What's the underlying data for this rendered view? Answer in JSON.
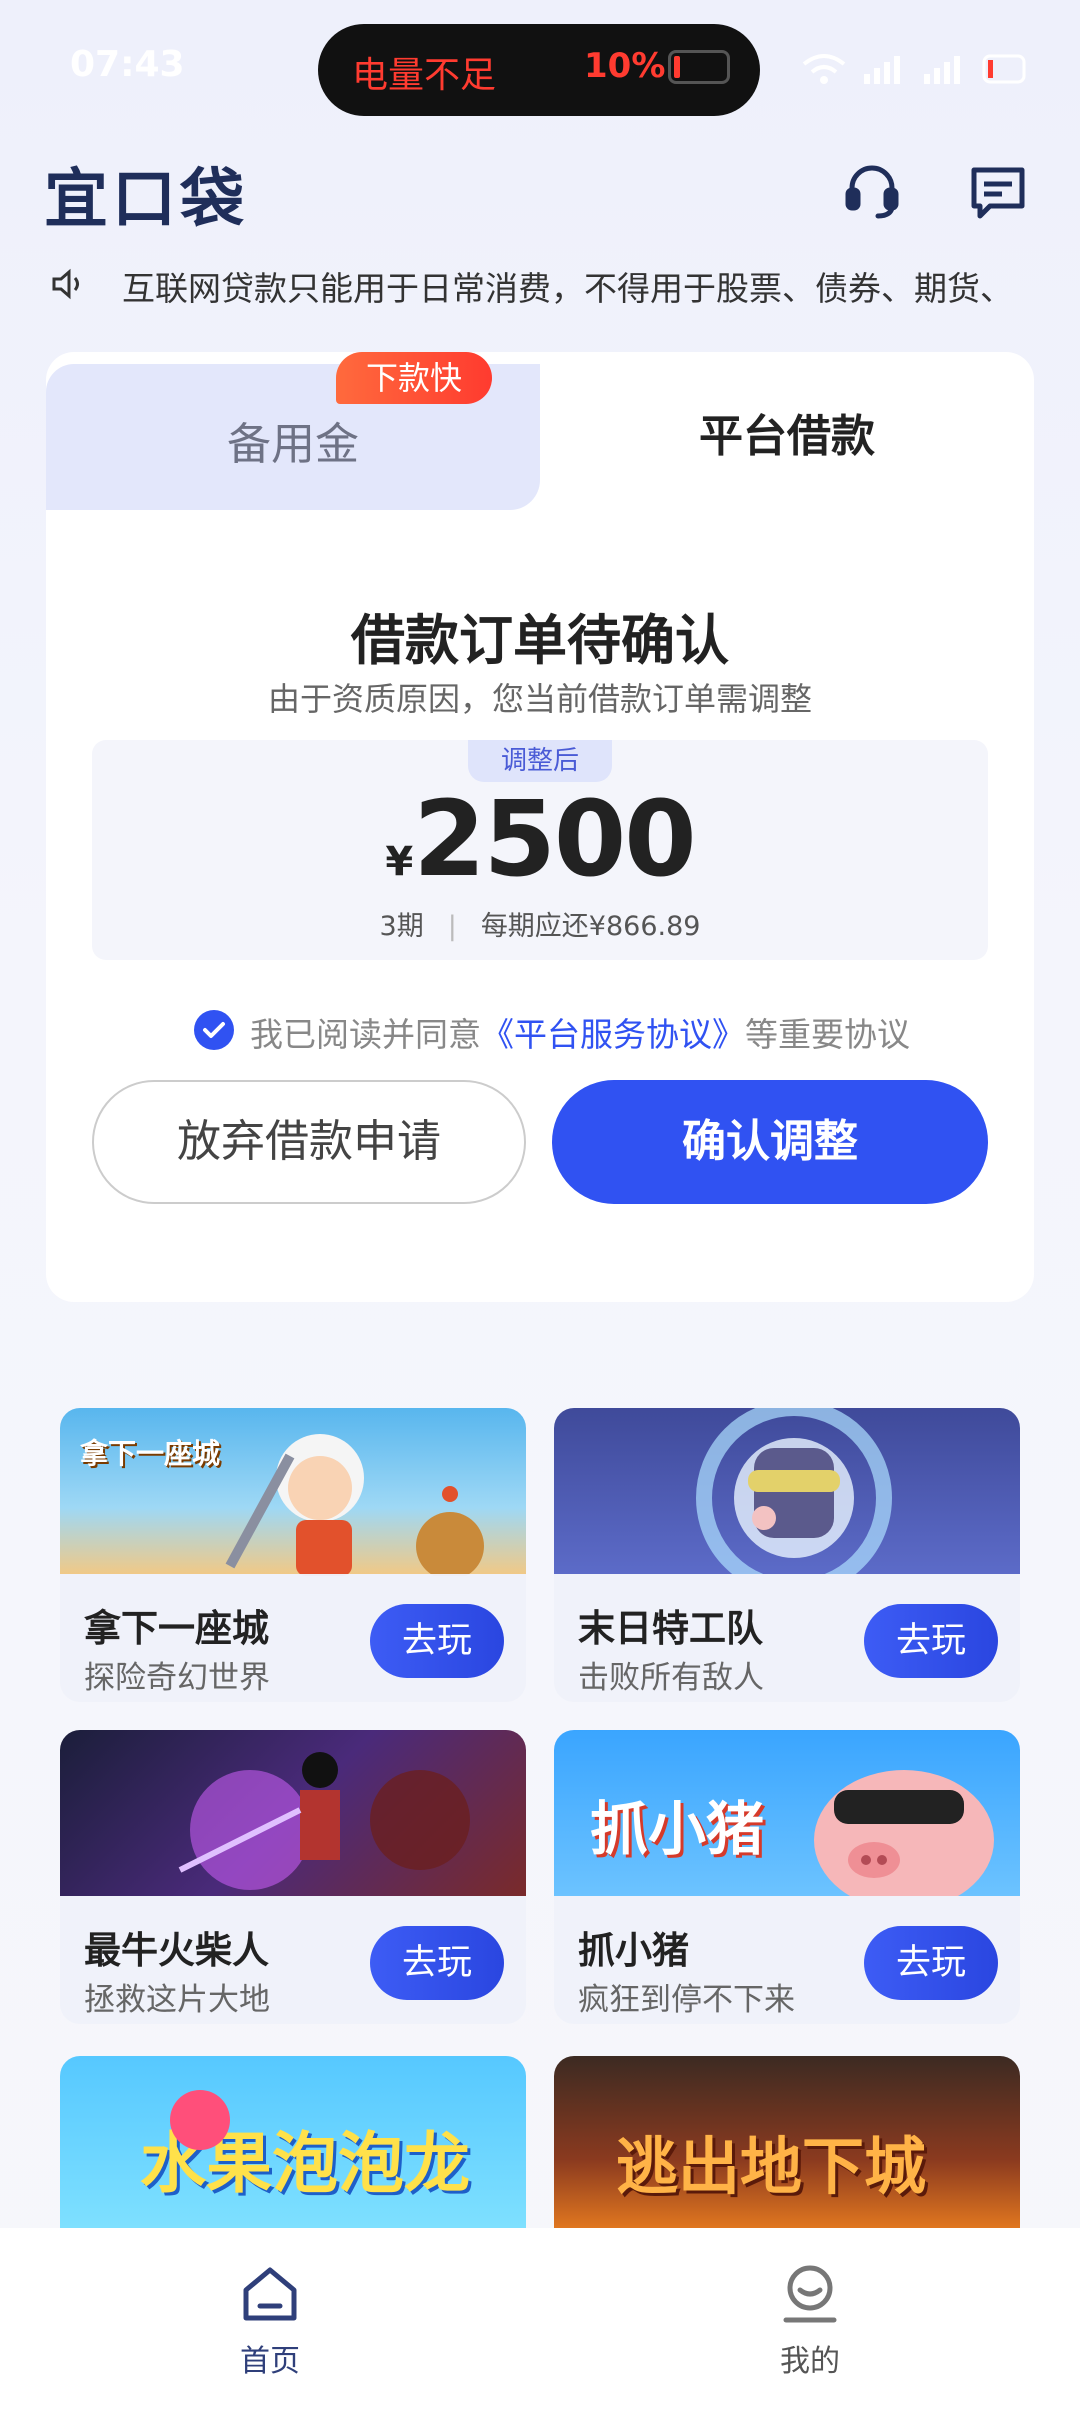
{
  "status_bar": {
    "time": "07:43",
    "battery_warning": "电量不足",
    "battery_percent": "10%",
    "right_icons": "wifi signal signal battery"
  },
  "header": {
    "logo_text": "宜口袋",
    "icons": [
      "headset-icon",
      "message-icon"
    ]
  },
  "notice": {
    "icon": "speaker-icon",
    "text": "互联网贷款只能用于日常消费，不得用于股票、债券、期货、"
  },
  "tabs": [
    {
      "label": "备用金",
      "badge": "下款快",
      "active": false
    },
    {
      "label": "平台借款",
      "active": true
    }
  ],
  "order": {
    "title": "借款订单待确认",
    "subtitle": "由于资质原因，您当前借款订单需调整",
    "adjusted_label": "调整后",
    "currency": "¥",
    "amount": "2500",
    "periods": "3期",
    "per_period": "每期应还¥866.89"
  },
  "agreement": {
    "prefix": "我已阅读并同意",
    "link": "《平台服务协议》",
    "suffix": "等重要协议",
    "checked": true
  },
  "buttons": {
    "cancel": "放弃借款申请",
    "confirm": "确认调整"
  },
  "games": [
    {
      "title": "拿下一座城",
      "subtitle": "探险奇幻世界",
      "button": "去玩",
      "art_text": "拿下一座城"
    },
    {
      "title": "末日特工队",
      "subtitle": "击败所有敌人",
      "button": "去玩",
      "art_text": ""
    },
    {
      "title": "最牛火柴人",
      "subtitle": "拯救这片大地",
      "button": "去玩",
      "art_text": ""
    },
    {
      "title": "抓小猪",
      "subtitle": "疯狂到停不下来",
      "button": "去玩",
      "art_text": "抓小猪"
    },
    {
      "title": "",
      "subtitle": "",
      "button": "",
      "art_text": "水果泡泡龙"
    },
    {
      "title": "",
      "subtitle": "",
      "button": "",
      "art_text": "逃出地下城"
    }
  ],
  "bottom_nav": [
    {
      "label": "首页",
      "icon": "home-icon",
      "active": true
    },
    {
      "label": "我的",
      "icon": "profile-icon",
      "active": false
    }
  ],
  "colors": {
    "primary": "#3052f2",
    "badge": "#ff4a33",
    "tab_inactive_bg": "#e3e7fb",
    "warning_red": "#ff3b30"
  }
}
